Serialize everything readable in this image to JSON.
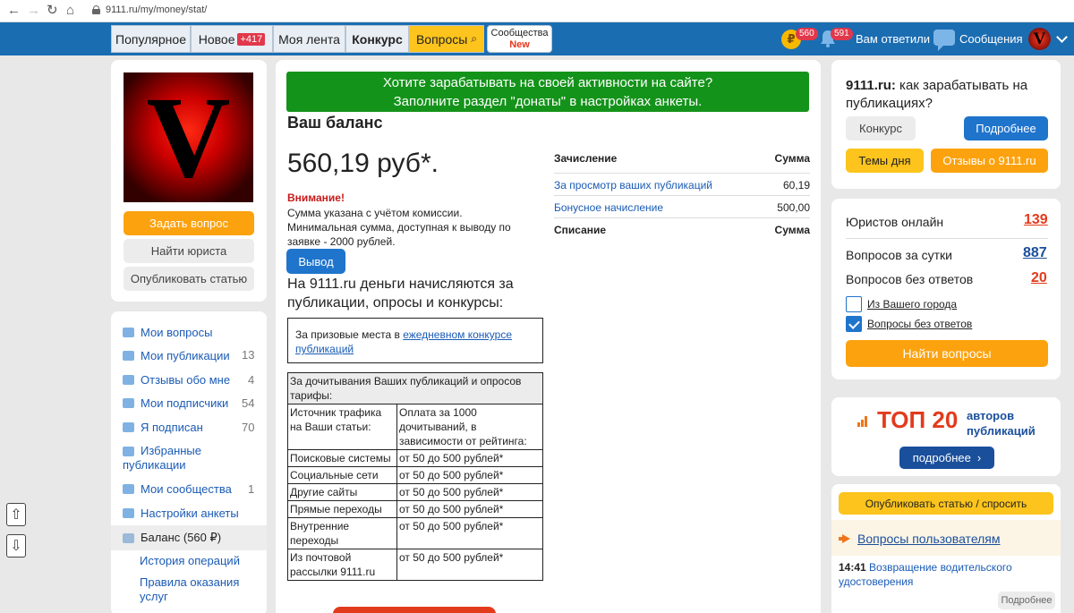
{
  "browser": {
    "url": "9111.ru/my/money/stat/"
  },
  "nav": {
    "popular": "Популярное",
    "new": "Новое",
    "new_badge": "+417",
    "feed": "Моя лента",
    "contest": "Конкурс",
    "questions": "Вопросы",
    "communities": "Сообщества",
    "communities_badge": "New",
    "coin_badge": "560",
    "bell_badge": "591",
    "answered": "Вам ответили",
    "messages": "Сообщения"
  },
  "left": {
    "avatar_letter": "V",
    "ask_button": "Задать вопрос",
    "find_lawyer_button": "Найти юриста",
    "publish_button": "Опубликовать статью",
    "menu": [
      {
        "label": "Мои вопросы",
        "count": ""
      },
      {
        "label": "Мои публикации",
        "count": "13"
      },
      {
        "label": "Отзывы обо мне",
        "count": "4"
      },
      {
        "label": "Мои подписчики",
        "count": "54"
      },
      {
        "label": "Я подписан",
        "count": "70"
      },
      {
        "label": "Избранные публикации",
        "count": ""
      },
      {
        "label": "Мои сообщества",
        "count": "1"
      },
      {
        "label": "Настройки анкеты",
        "count": ""
      },
      {
        "label": "Баланс (560 ₽)",
        "count": ""
      },
      {
        "label": "История операций",
        "count": ""
      },
      {
        "label": "Правила оказания услуг",
        "count": ""
      }
    ]
  },
  "main": {
    "banner_line1": "Хотите зарабатывать на своей активности на сайте?",
    "banner_line2": "Заполните раздел \"донаты\" в настройках анкеты.",
    "title": "Ваш баланс",
    "balance": "560,19 руб*.",
    "warning_title": "Внимание!",
    "warning_text": "Сумма указана с учётом комиссии. Минимальная сумма, доступная к выводу по заявке - 2000 рублей.",
    "withdraw_button": "Вывод",
    "earn_heading": "На 9111.ru деньги начисляются за публикации, опросы и конкурсы:",
    "prize_text": "За призовые места в ",
    "prize_link": "ежедневном конкурсе публикаций",
    "tariff_header": "За дочитывания Ваших публикаций и опросов тарифы:",
    "tariff_col1": "Источник трафика на Ваши статьи:",
    "tariff_col2": "Оплата за 1000 дочитываний, в зависимости от рейтинга:",
    "tariffs": [
      {
        "source": "Поисковые системы",
        "price": "от 50 до 500 рублей*"
      },
      {
        "source": "Социальные сети",
        "price": "от 50 до 500 рублей*"
      },
      {
        "source": "Другие сайты",
        "price": "от 50 до 500 рублей*"
      },
      {
        "source": "Прямые переходы",
        "price": "от 50 до 500 рублей*"
      },
      {
        "source": "Внутренние переходы",
        "price": "от 50 до 500 рублей*"
      },
      {
        "source": "Из почтовой рассылки 9111.ru",
        "price": "от 50 до 500 рублей*"
      }
    ],
    "income_header": "Зачисление",
    "sum_header": "Сумма",
    "income_rows": [
      {
        "label": "За просмотр ваших публикаций",
        "value": "60,19"
      },
      {
        "label": "Бонусное начисление",
        "value": "500,00"
      }
    ],
    "expense_header": "Списание",
    "expense_sum_header": "Сумма"
  },
  "right": {
    "earn_title_bold": "9111.ru:",
    "earn_title_rest": " как зарабатывать на публикациях?",
    "contest_button": "Конкурс",
    "more_button": "Подробнее",
    "topics_button": "Темы дня",
    "reviews_button": "Отзывы о 9111.ru",
    "lawyers_online": "Юристов онлайн",
    "lawyers_online_num": "139",
    "questions_day": "Вопросов за сутки",
    "questions_day_num": "887",
    "questions_noans": "Вопросов без ответов",
    "questions_noans_num": "20",
    "from_city": "Из Вашего города",
    "without_answers": "Вопросы без ответов",
    "find_questions_button": "Найти вопросы",
    "top_title": "ТОП 20",
    "top_sub": "авторов публикаций",
    "top_more": "подробнее",
    "publish_ask": "Опубликовать статью / спросить",
    "user_questions": "Вопросы пользователям",
    "q_time": "14:41",
    "q_text": "Возвращение водительского удостоверения",
    "q_more": "Подробнее"
  },
  "colors": {
    "nav_blue": "#1b6db2",
    "orange": "#fca20e",
    "blue_btn": "#1f74cc",
    "red_num": "#e23b1c",
    "banner_green": "#14931a"
  }
}
